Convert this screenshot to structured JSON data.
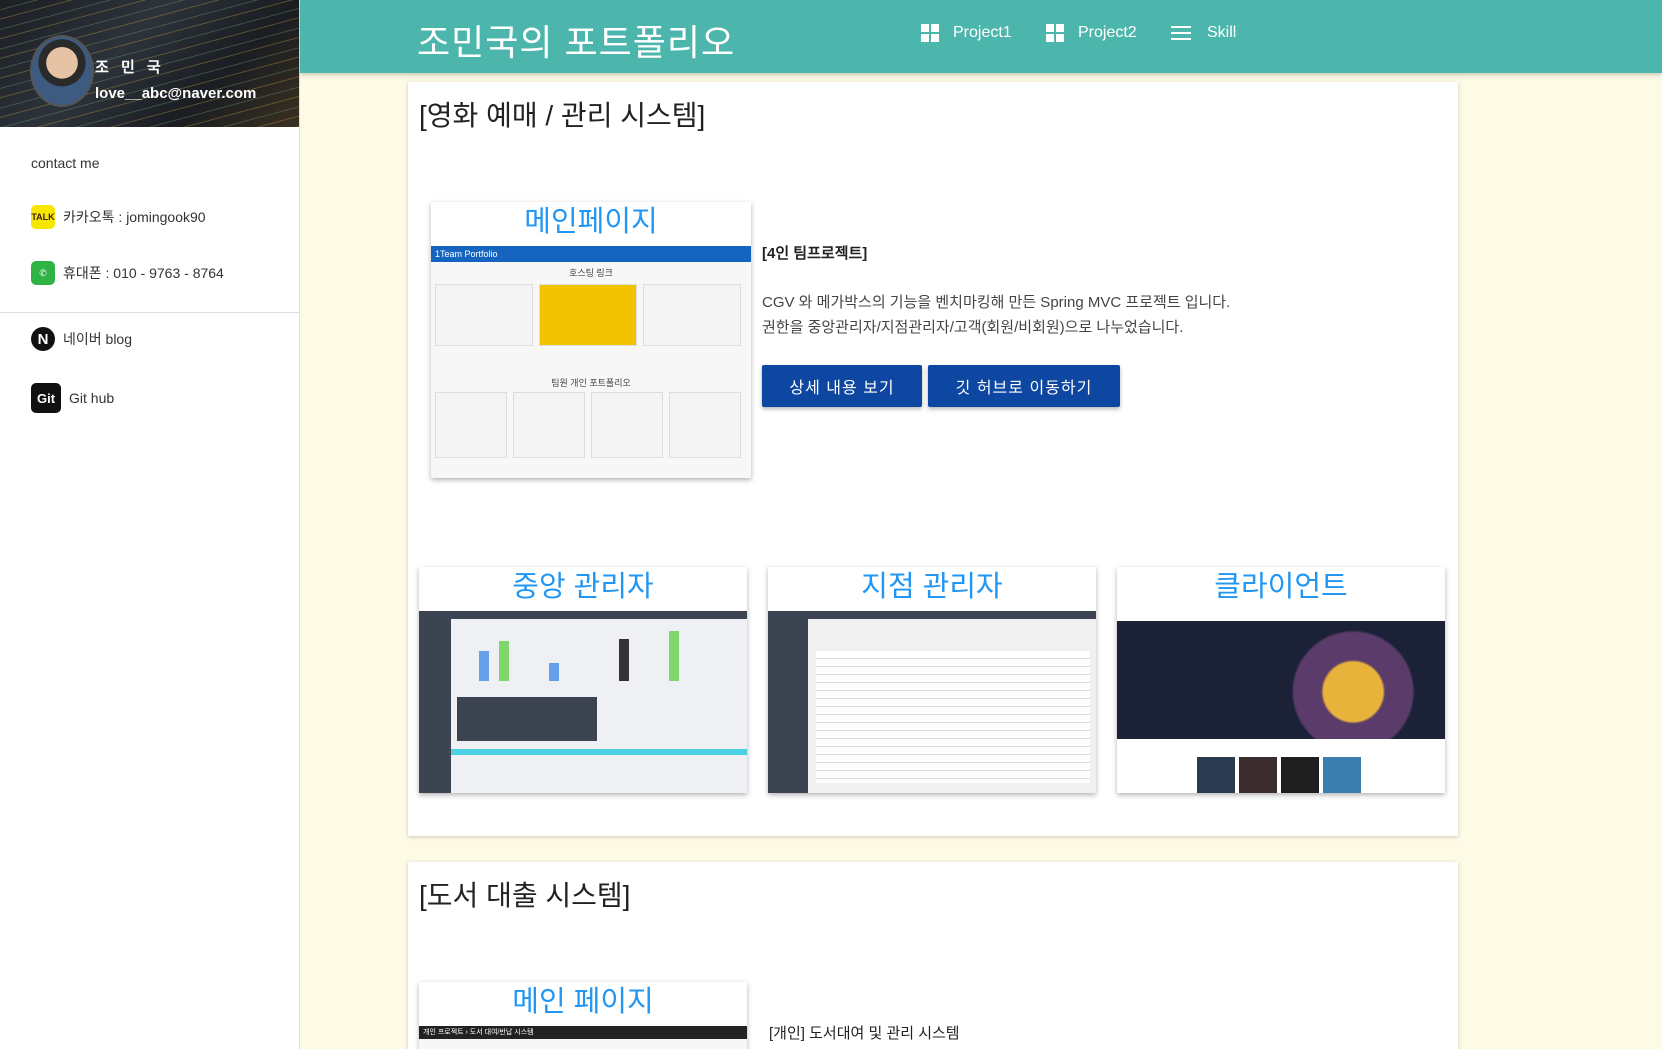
{
  "sidebar": {
    "profile": {
      "name": "조 민 국",
      "email": "love__abc@naver.com"
    },
    "contact_title": "contact me",
    "items": [
      {
        "icon": "kakaotalk-icon",
        "icon_text": "TALK",
        "label": "카카오톡 : jomingook90"
      },
      {
        "icon": "whatsapp-phone-icon",
        "icon_text": "✆",
        "label": "휴대폰 : 010 - 9763 - 8764"
      },
      {
        "icon": "naver-icon",
        "icon_text": "N",
        "label": "네이버 blog"
      },
      {
        "icon": "github-icon",
        "icon_text": "Git",
        "label": "Git hub"
      }
    ]
  },
  "header": {
    "title": "조민국의 포트폴리오",
    "nav": [
      {
        "icon": "grid-icon",
        "label": "Project1"
      },
      {
        "icon": "grid-icon",
        "label": "Project2"
      },
      {
        "icon": "list-icon",
        "label": "Skill"
      }
    ]
  },
  "project1": {
    "title": "[영화 예매 / 관리 시스템]",
    "main_shot": {
      "label": "메인페이지",
      "bar_text": "1Team Portfolio",
      "hosting": "호스팅 링크",
      "members": "팀원 개인 포트폴리오"
    },
    "subtitle": "[4인 팀프로젝트]",
    "description_1": "CGV 와 메가박스의 기능을 벤치마킹해 만든 Spring MVC 프로젝트 입니다.",
    "description_2": "권한을 중앙관리자/지점관리자/고객(회원/비회원)으로 나누었습니다.",
    "btn_detail": "상세 내용 보기",
    "btn_github": "깃 허브로 이동하기",
    "shots": [
      "중앙 관리자",
      "지점 관리자",
      "클라이언트"
    ]
  },
  "project2": {
    "title": "[도서 대출 시스템]",
    "main_shot": {
      "label": "메인 페이지",
      "bar_text": "개인 프로젝트 › 도서 대여/반납 시스템"
    },
    "subtitle": "[개인] 도서대여 및 관리 시스템"
  },
  "colors": {
    "topbar": "#4db6ac",
    "accent": "#2196f3",
    "button": "#0d47a1",
    "background": "#fdfae6"
  }
}
